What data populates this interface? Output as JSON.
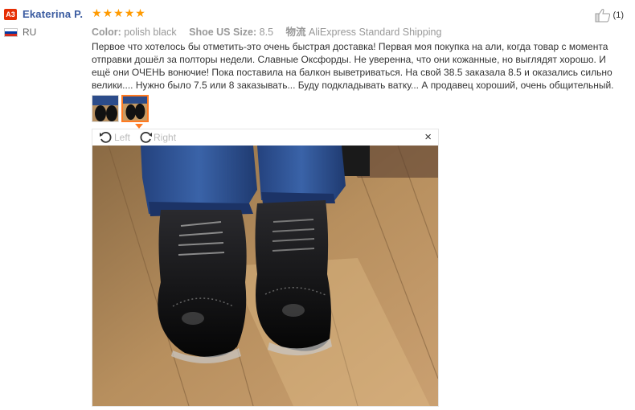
{
  "reviewer": {
    "badge": "A3",
    "name": "Ekaterina P.",
    "country": "RU"
  },
  "rating": {
    "stars": 5,
    "max": 5
  },
  "attributes": {
    "color_label": "Color:",
    "color_value": "polish black",
    "size_label": "Shoe US Size:",
    "size_value": "8.5",
    "shipping_label": "物流",
    "shipping_value": "AliExpress Standard Shipping"
  },
  "helpful": {
    "count": "(1)"
  },
  "review_text": "Первое что хотелось бы отметить-это очень быстрая доставка! Первая моя покупка на али, когда товар с момента отправки дошёл за полторы недели. Славные Оксфорды. Не уверенна, что они кожанные, но выглядят хорошо. И ещё они ОЧЕНЬ вонючие! Пока поставила на балкон выветриваться. На свой 38.5 заказала 8.5 и оказались сильно велики.... Нужно было 7.5 или 8 заказывать... Буду подкладывать ватку... А продавец хороший, очень общительный.",
  "viewer": {
    "rotate_left": "Left",
    "rotate_right": "Right",
    "close": "×"
  },
  "colors": {
    "accent": "#ff7a22",
    "star": "#ff9a00",
    "username": "#3a5ba0",
    "badge": "#e62e04"
  },
  "thumbnails": [
    {
      "name": "photo-1",
      "active": false
    },
    {
      "name": "photo-2",
      "active": true
    }
  ]
}
